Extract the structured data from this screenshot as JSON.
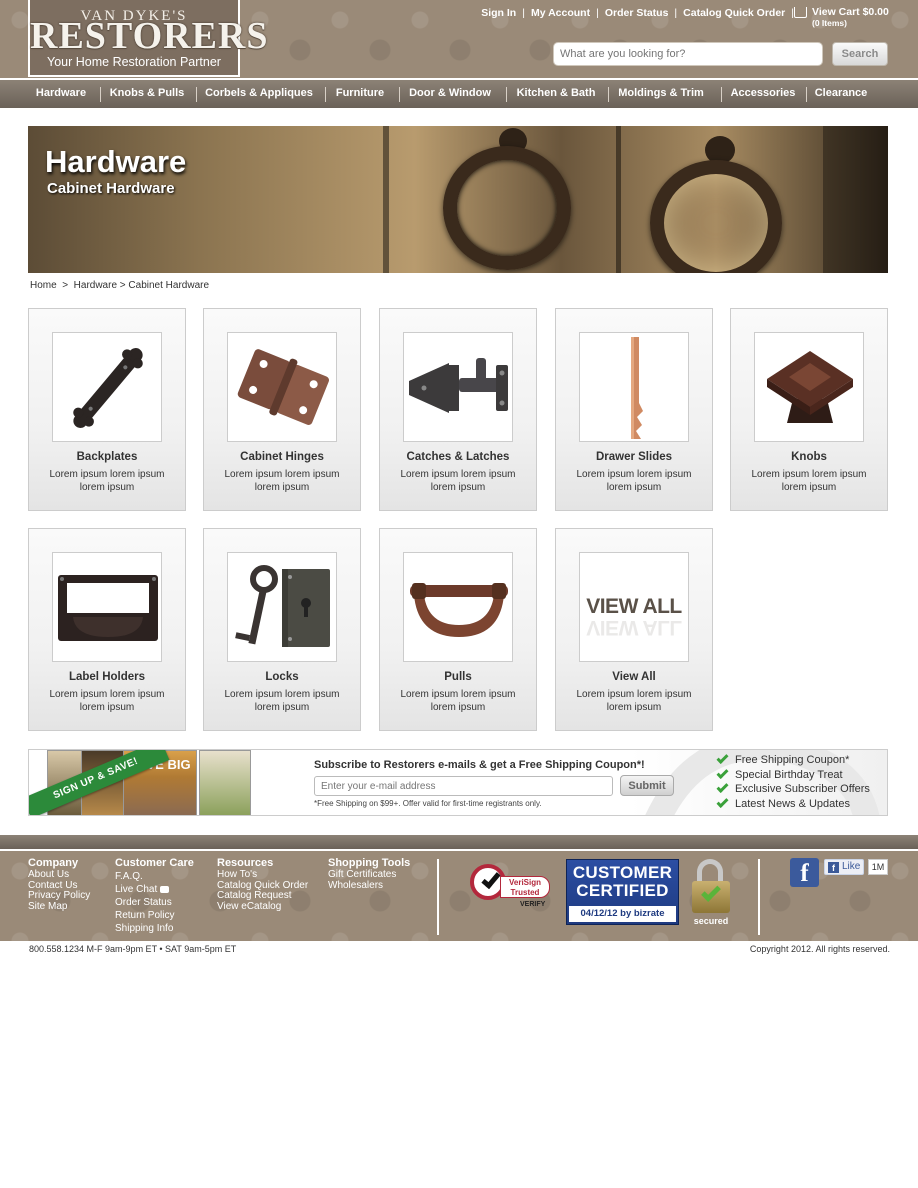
{
  "brand": {
    "logo_small": "VAN DYKE'S",
    "logo_main": "RESTORERS",
    "tagline": "Your Home Restoration Partner"
  },
  "toplinks": [
    "Sign In",
    "My Account",
    "Order Status",
    "Catalog Quick Order"
  ],
  "cart": {
    "label": "View Cart  $0.00",
    "items": "(0 Items)"
  },
  "search": {
    "placeholder": "What are you looking for?",
    "button": "Search"
  },
  "nav": [
    "Hardware",
    "Knobs & Pulls",
    "Corbels & Appliques",
    "Furniture",
    "Door & Window",
    "Kitchen & Bath",
    "Moldings & Trim",
    "Accessories",
    "Clearance"
  ],
  "banner": {
    "title": "Hardware",
    "subtitle": "Cabinet Hardware"
  },
  "breadcrumb": {
    "home": "Home",
    "sep1": ">",
    "parent": "Hardware",
    "sep2": ">",
    "current": "Cabinet Hardware"
  },
  "categories": [
    {
      "name": "Backplates",
      "desc": "Lorem ipsum lorem ipsum lorem ipsum"
    },
    {
      "name": "Cabinet Hinges",
      "desc": "Lorem ipsum lorem ipsum lorem ipsum"
    },
    {
      "name": "Catches & Latches",
      "desc": "Lorem ipsum lorem ipsum lorem ipsum"
    },
    {
      "name": "Drawer Slides",
      "desc": "Lorem ipsum lorem ipsum lorem ipsum"
    },
    {
      "name": "Knobs",
      "desc": "Lorem ipsum lorem ipsum lorem ipsum"
    },
    {
      "name": "Label Holders",
      "desc": "Lorem ipsum lorem ipsum lorem ipsum"
    },
    {
      "name": "Locks",
      "desc": "Lorem ipsum lorem ipsum lorem ipsum"
    },
    {
      "name": "Pulls",
      "desc": "Lorem ipsum lorem ipsum lorem ipsum"
    },
    {
      "name": "View All",
      "desc": "Lorem ipsum lorem ipsum lorem ipsum",
      "image_text": "VIEW ALL"
    }
  ],
  "newsletter": {
    "ribbon": "SIGN UP & SAVE!",
    "catalog_text": "SAVE BIG",
    "headline": "Subscribe to Restorers e-mails & get a Free Shipping Coupon*!",
    "placeholder": "Enter your e-mail address",
    "submit": "Submit",
    "note": "*Free Shipping on $99+. Offer valid for first-time registrants only.",
    "benefits": [
      "Free Shipping Coupon*",
      "Special Birthday Treat",
      "Exclusive Subscriber Offers",
      "Latest News & Updates"
    ]
  },
  "footer": {
    "columns": [
      {
        "title": "Company",
        "links": [
          "About Us",
          "Contact Us",
          "Privacy Policy",
          "Site Map"
        ]
      },
      {
        "title": "Customer Care",
        "links": [
          "F.A.Q.",
          "Live Chat",
          "Order Status",
          "Return Policy",
          "Shipping Info"
        ]
      },
      {
        "title": "Resources",
        "links": [
          "How To's",
          "Catalog Quick Order",
          "Catalog Request",
          "View eCatalog"
        ]
      },
      {
        "title": "Shopping Tools",
        "links": [
          "Gift Certificates",
          "Wholesalers"
        ]
      }
    ],
    "verisign": {
      "line1": "VeriSign",
      "line2": "Trusted",
      "verify": "VERIFY"
    },
    "customer_certified": {
      "line1": "CUSTOMER",
      "line2": "CERTIFIED",
      "date": "04/12/12 by bizrate"
    },
    "secured": "secured",
    "like": "Like",
    "like_count": "1M",
    "phone_hours": "800.558.1234  M-F 9am-9pm ET • SAT 9am-5pm ET",
    "copyright": "Copyright 2012.  All rights reserved."
  },
  "colors": {
    "header_bg": "#9a8a78",
    "nav_bg": "#6a6158",
    "accent_green": "#2c8a3a"
  }
}
